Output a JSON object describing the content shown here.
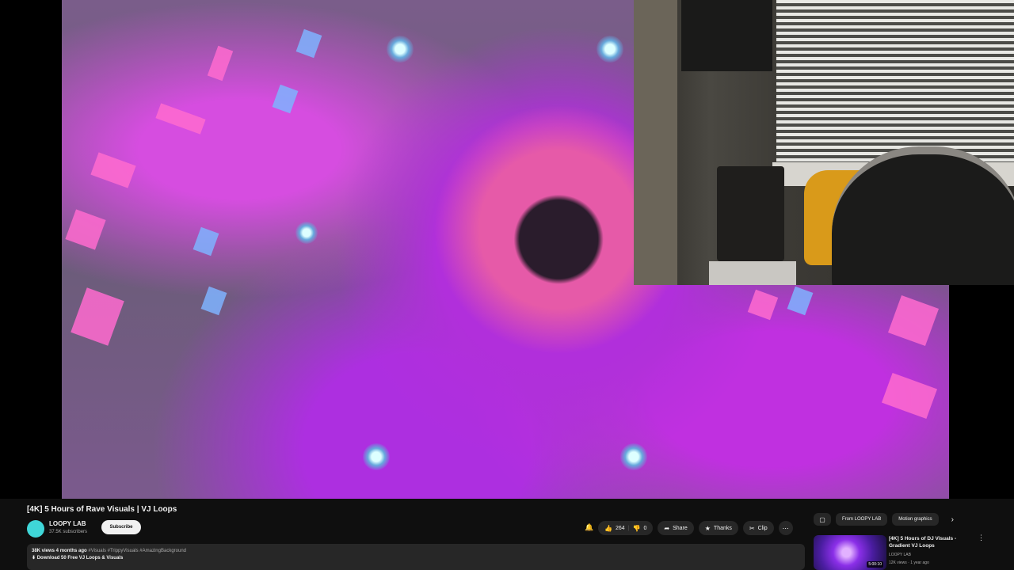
{
  "video": {
    "title": "[4K] 5 Hours of Rave Visuals | VJ Loops"
  },
  "channel": {
    "name": "LOOPY LAB",
    "subscribers": "37.5K subscribers",
    "subscribe_label": "Subscribe"
  },
  "actions": {
    "like_count": "264",
    "dislike_count": "0",
    "share_label": "Share",
    "thanks_label": "Thanks",
    "clip_label": "Clip",
    "more_label": "⋯"
  },
  "description": {
    "meta": "38K views  4 months ago",
    "tags": "#Visuals #TrippyVisuals #AmazingBackground",
    "download_line": "⬇ Download 50 Free VJ Loops & Visuals"
  },
  "sidebar": {
    "chips": [
      "From LOOPY LAB",
      "Motion graphics"
    ],
    "chip_next_icon": "›",
    "recommendation": {
      "title": "[4K] 5 Hours of DJ Visuals - Gradient VJ Loops",
      "channel": "LOOPY LAB",
      "meta": "12K views · 1 year ago",
      "duration": "5:00:10"
    }
  },
  "icons": {
    "all_chip": "all-icon",
    "like": "thumbs-up-icon",
    "dislike": "thumbs-down-icon",
    "share": "share-icon",
    "thanks": "thanks-icon",
    "clip": "scissors-icon",
    "bell": "bell-icon",
    "more": "more-vert-icon"
  }
}
